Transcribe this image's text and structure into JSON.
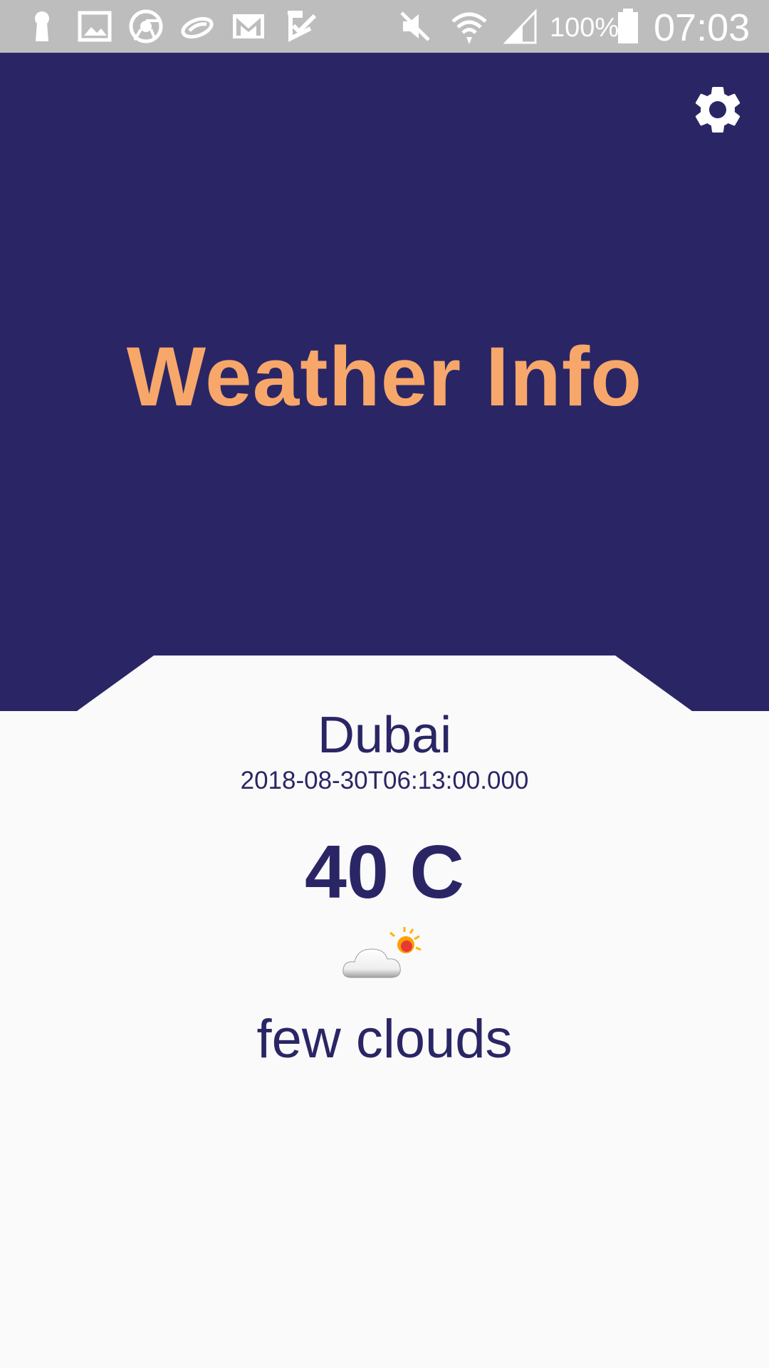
{
  "status_bar": {
    "battery_percent": "100%",
    "time": "07:03",
    "icons": [
      "keyhole-icon",
      "gallery-icon",
      "chrome-icon",
      "link-icon",
      "gmail-icon",
      "checkbox-app-icon",
      "mute-icon",
      "wifi-icon",
      "signal-icon",
      "battery-icon"
    ]
  },
  "header": {
    "title": "Weather Info",
    "settings_icon": "gear-icon",
    "background_color": "#2a2665",
    "title_color": "#f8a76b"
  },
  "weather": {
    "city": "Dubai",
    "timestamp": "2018-08-30T06:13:00.000",
    "temperature": "40 C",
    "condition_icon": "few-clouds-icon",
    "condition": "few clouds"
  }
}
